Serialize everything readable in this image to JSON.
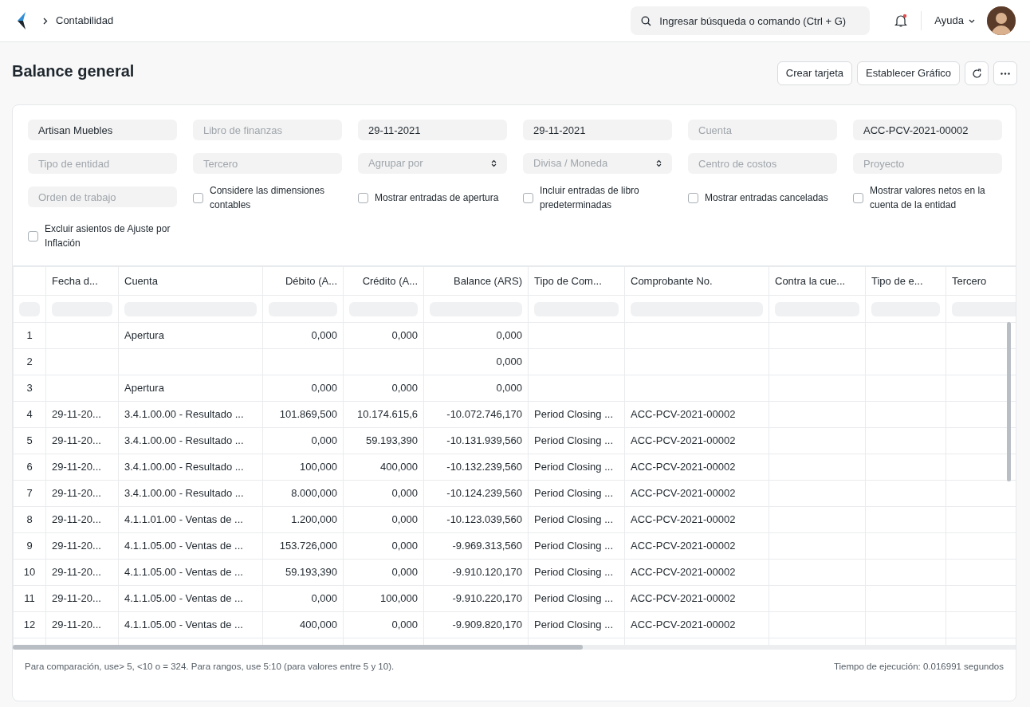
{
  "breadcrumb": [
    {
      "label": "Contabilidad"
    }
  ],
  "search": {
    "placeholder": "Ingresar búsqueda o comando (Ctrl + G)"
  },
  "notifications": {
    "unread": true
  },
  "help_menu": {
    "label": "Ayuda"
  },
  "page": {
    "title": "Balance general",
    "actions": [
      "Crear tarjeta",
      "Establecer Gráfico"
    ]
  },
  "filters": [
    {
      "kind": "input",
      "value": "Artisan Muebles"
    },
    {
      "kind": "input",
      "placeholder": "Libro de finanzas"
    },
    {
      "kind": "input",
      "value": "29-11-2021"
    },
    {
      "kind": "input",
      "value": "29-11-2021"
    },
    {
      "kind": "input",
      "placeholder": "Cuenta"
    },
    {
      "kind": "input",
      "value": "ACC-PCV-2021-00002"
    },
    {
      "kind": "input",
      "placeholder": "Tipo de entidad"
    },
    {
      "kind": "input",
      "placeholder": "Tercero"
    },
    {
      "kind": "select",
      "placeholder": "Agrupar por"
    },
    {
      "kind": "select",
      "placeholder": "Divisa / Moneda"
    },
    {
      "kind": "input",
      "placeholder": "Centro de costos"
    },
    {
      "kind": "input",
      "placeholder": "Proyecto"
    },
    {
      "kind": "input",
      "placeholder": "Orden de trabajo"
    },
    {
      "kind": "checkbox",
      "label": "Considere las dimensiones contables",
      "checked": false
    },
    {
      "kind": "checkbox",
      "label": "Mostrar entradas de apertura",
      "checked": false
    },
    {
      "kind": "checkbox",
      "label": "Incluir entradas de libro predeterminadas",
      "checked": false
    },
    {
      "kind": "checkbox",
      "label": "Mostrar entradas canceladas",
      "checked": false
    },
    {
      "kind": "checkbox",
      "label": "Mostrar valores netos en la cuenta de la entidad",
      "checked": false
    },
    {
      "kind": "checkbox",
      "label": "Excluir asientos de Ajuste por Inflación",
      "checked": false
    }
  ],
  "table": {
    "columns": [
      {
        "label": "Fecha d...",
        "kind": "text"
      },
      {
        "label": "Cuenta",
        "kind": "text"
      },
      {
        "label": "Débito (A...",
        "kind": "amount"
      },
      {
        "label": "Crédito (A...",
        "kind": "amount"
      },
      {
        "label": "Balance (ARS)",
        "kind": "amount"
      },
      {
        "label": "Tipo de Com...",
        "kind": "text"
      },
      {
        "label": "Comprobante No.",
        "kind": "text"
      },
      {
        "label": "Contra la cue...",
        "kind": "text"
      },
      {
        "label": "Tipo de e...",
        "kind": "text"
      },
      {
        "label": "Tercero",
        "kind": "text"
      }
    ],
    "rows": [
      {
        "number": "1",
        "cells": [
          null,
          "Apertura",
          "0,000",
          "0,000",
          "0,000",
          null,
          null,
          null,
          null,
          null
        ]
      },
      {
        "number": "2",
        "cells": [
          null,
          null,
          null,
          null,
          "0,000",
          null,
          null,
          null,
          null,
          null
        ]
      },
      {
        "number": "3",
        "cells": [
          null,
          "Apertura",
          "0,000",
          "0,000",
          "0,000",
          null,
          null,
          null,
          null,
          null
        ]
      },
      {
        "number": "4",
        "cells": [
          "29-11-20...",
          "3.4.1.00.00 - Resultado ...",
          "101.869,500",
          "10.174.615,6",
          "-10.072.746,170",
          "Period Closing ...",
          "ACC-PCV-2021-00002",
          null,
          null,
          null
        ]
      },
      {
        "number": "5",
        "cells": [
          "29-11-20...",
          "3.4.1.00.00 - Resultado ...",
          "0,000",
          "59.193,390",
          "-10.131.939,560",
          "Period Closing ...",
          "ACC-PCV-2021-00002",
          null,
          null,
          null
        ]
      },
      {
        "number": "6",
        "cells": [
          "29-11-20...",
          "3.4.1.00.00 - Resultado ...",
          "100,000",
          "400,000",
          "-10.132.239,560",
          "Period Closing ...",
          "ACC-PCV-2021-00002",
          null,
          null,
          null
        ]
      },
      {
        "number": "7",
        "cells": [
          "29-11-20...",
          "3.4.1.00.00 - Resultado ...",
          "8.000,000",
          "0,000",
          "-10.124.239,560",
          "Period Closing ...",
          "ACC-PCV-2021-00002",
          null,
          null,
          null
        ]
      },
      {
        "number": "8",
        "cells": [
          "29-11-20...",
          "4.1.1.01.00 - Ventas de ...",
          "1.200,000",
          "0,000",
          "-10.123.039,560",
          "Period Closing ...",
          "ACC-PCV-2021-00002",
          null,
          null,
          null
        ]
      },
      {
        "number": "9",
        "cells": [
          "29-11-20...",
          "4.1.1.05.00 - Ventas de ...",
          "153.726,000",
          "0,000",
          "-9.969.313,560",
          "Period Closing ...",
          "ACC-PCV-2021-00002",
          null,
          null,
          null
        ]
      },
      {
        "number": "10",
        "cells": [
          "29-11-20...",
          "4.1.1.05.00 - Ventas de ...",
          "59.193,390",
          "0,000",
          "-9.910.120,170",
          "Period Closing ...",
          "ACC-PCV-2021-00002",
          null,
          null,
          null
        ]
      },
      {
        "number": "11",
        "cells": [
          "29-11-20...",
          "4.1.1.05.00 - Ventas de ...",
          "0,000",
          "100,000",
          "-9.910.220,170",
          "Period Closing ...",
          "ACC-PCV-2021-00002",
          null,
          null,
          null
        ]
      },
      {
        "number": "12",
        "cells": [
          "29-11-20...",
          "4.1.1.05.00 - Ventas de ...",
          "400,000",
          "0,000",
          "-9.909.820,170",
          "Period Closing ...",
          "ACC-PCV-2021-00002",
          null,
          null,
          null
        ]
      }
    ]
  },
  "footer": {
    "hint": "Para comparación, use> 5, <10 o = 324. Para rangos, use 5:10 (para valores entre 5 y 10).",
    "execution_time": "Tiempo de ejecución: 0.016991 segundos"
  }
}
